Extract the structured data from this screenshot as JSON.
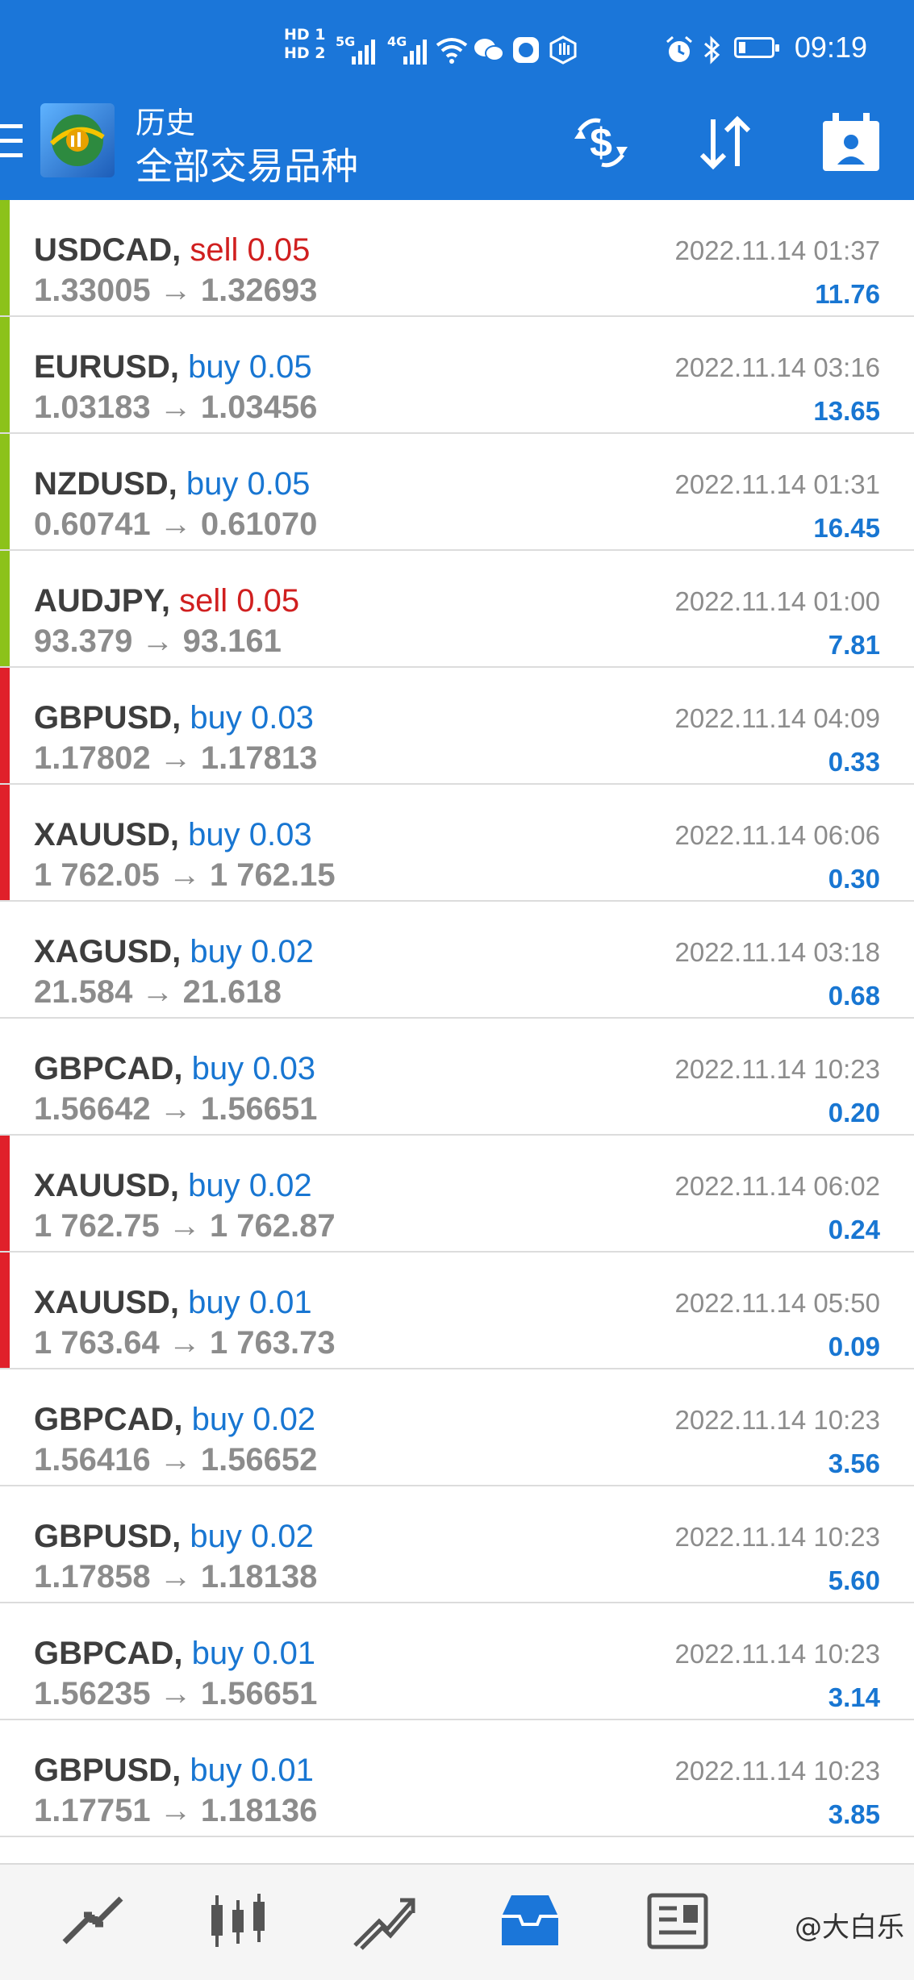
{
  "status_bar": {
    "hd1": "HD 1",
    "hd2": "HD 2",
    "net1": "5G",
    "net2": "4G",
    "time": "09:19",
    "icons": [
      "wifi-icon",
      "wechat-icon",
      "app-icon",
      "hand-icon",
      "alarm-icon",
      "bluetooth-icon",
      "battery-icon"
    ]
  },
  "app_bar": {
    "title": "历史",
    "subtitle": "全部交易品种",
    "accent_color": "#1b76d9",
    "actions": [
      "currency-filter-icon",
      "sort-icon",
      "calendar-icon"
    ]
  },
  "trades": [
    {
      "symbol": "USDCAD,",
      "side": "sell",
      "lot": "0.05",
      "open": "1.33005",
      "close": "1.32693",
      "time": "2022.11.14 01:37",
      "profit": "11.76",
      "bar": "#8cc21a"
    },
    {
      "symbol": "EURUSD,",
      "side": "buy",
      "lot": "0.05",
      "open": "1.03183",
      "close": "1.03456",
      "time": "2022.11.14 03:16",
      "profit": "13.65",
      "bar": "#8cc21a"
    },
    {
      "symbol": "NZDUSD,",
      "side": "buy",
      "lot": "0.05",
      "open": "0.60741",
      "close": "0.61070",
      "time": "2022.11.14 01:31",
      "profit": "16.45",
      "bar": "#8cc21a"
    },
    {
      "symbol": "AUDJPY,",
      "side": "sell",
      "lot": "0.05",
      "open": "93.379",
      "close": "93.161",
      "time": "2022.11.14 01:00",
      "profit": "7.81",
      "bar": "#8cc21a"
    },
    {
      "symbol": "GBPUSD,",
      "side": "buy",
      "lot": "0.03",
      "open": "1.17802",
      "close": "1.17813",
      "time": "2022.11.14 04:09",
      "profit": "0.33",
      "bar": "#e0202a"
    },
    {
      "symbol": "XAUUSD,",
      "side": "buy",
      "lot": "0.03",
      "open": "1 762.05",
      "close": "1 762.15",
      "time": "2022.11.14 06:06",
      "profit": "0.30",
      "bar": "#e0202a"
    },
    {
      "symbol": "XAGUSD,",
      "side": "buy",
      "lot": "0.02",
      "open": "21.584",
      "close": "21.618",
      "time": "2022.11.14 03:18",
      "profit": "0.68",
      "bar": ""
    },
    {
      "symbol": "GBPCAD,",
      "side": "buy",
      "lot": "0.03",
      "open": "1.56642",
      "close": "1.56651",
      "time": "2022.11.14 10:23",
      "profit": "0.20",
      "bar": ""
    },
    {
      "symbol": "XAUUSD,",
      "side": "buy",
      "lot": "0.02",
      "open": "1 762.75",
      "close": "1 762.87",
      "time": "2022.11.14 06:02",
      "profit": "0.24",
      "bar": "#e0202a"
    },
    {
      "symbol": "XAUUSD,",
      "side": "buy",
      "lot": "0.01",
      "open": "1 763.64",
      "close": "1 763.73",
      "time": "2022.11.14 05:50",
      "profit": "0.09",
      "bar": "#e0202a"
    },
    {
      "symbol": "GBPCAD,",
      "side": "buy",
      "lot": "0.02",
      "open": "1.56416",
      "close": "1.56652",
      "time": "2022.11.14 10:23",
      "profit": "3.56",
      "bar": ""
    },
    {
      "symbol": "GBPUSD,",
      "side": "buy",
      "lot": "0.02",
      "open": "1.17858",
      "close": "1.18138",
      "time": "2022.11.14 10:23",
      "profit": "5.60",
      "bar": ""
    },
    {
      "symbol": "GBPCAD,",
      "side": "buy",
      "lot": "0.01",
      "open": "1.56235",
      "close": "1.56651",
      "time": "2022.11.14 10:23",
      "profit": "3.14",
      "bar": ""
    },
    {
      "symbol": "GBPUSD,",
      "side": "buy",
      "lot": "0.01",
      "open": "1.17751",
      "close": "1.18136",
      "time": "2022.11.14 10:23",
      "profit": "3.85",
      "bar": ""
    }
  ],
  "bottom_nav": {
    "items": [
      "quotes-icon",
      "chart-candles-icon",
      "trade-icon",
      "history-icon",
      "news-icon"
    ],
    "active": "history-icon",
    "watermark": "@大白乐"
  }
}
